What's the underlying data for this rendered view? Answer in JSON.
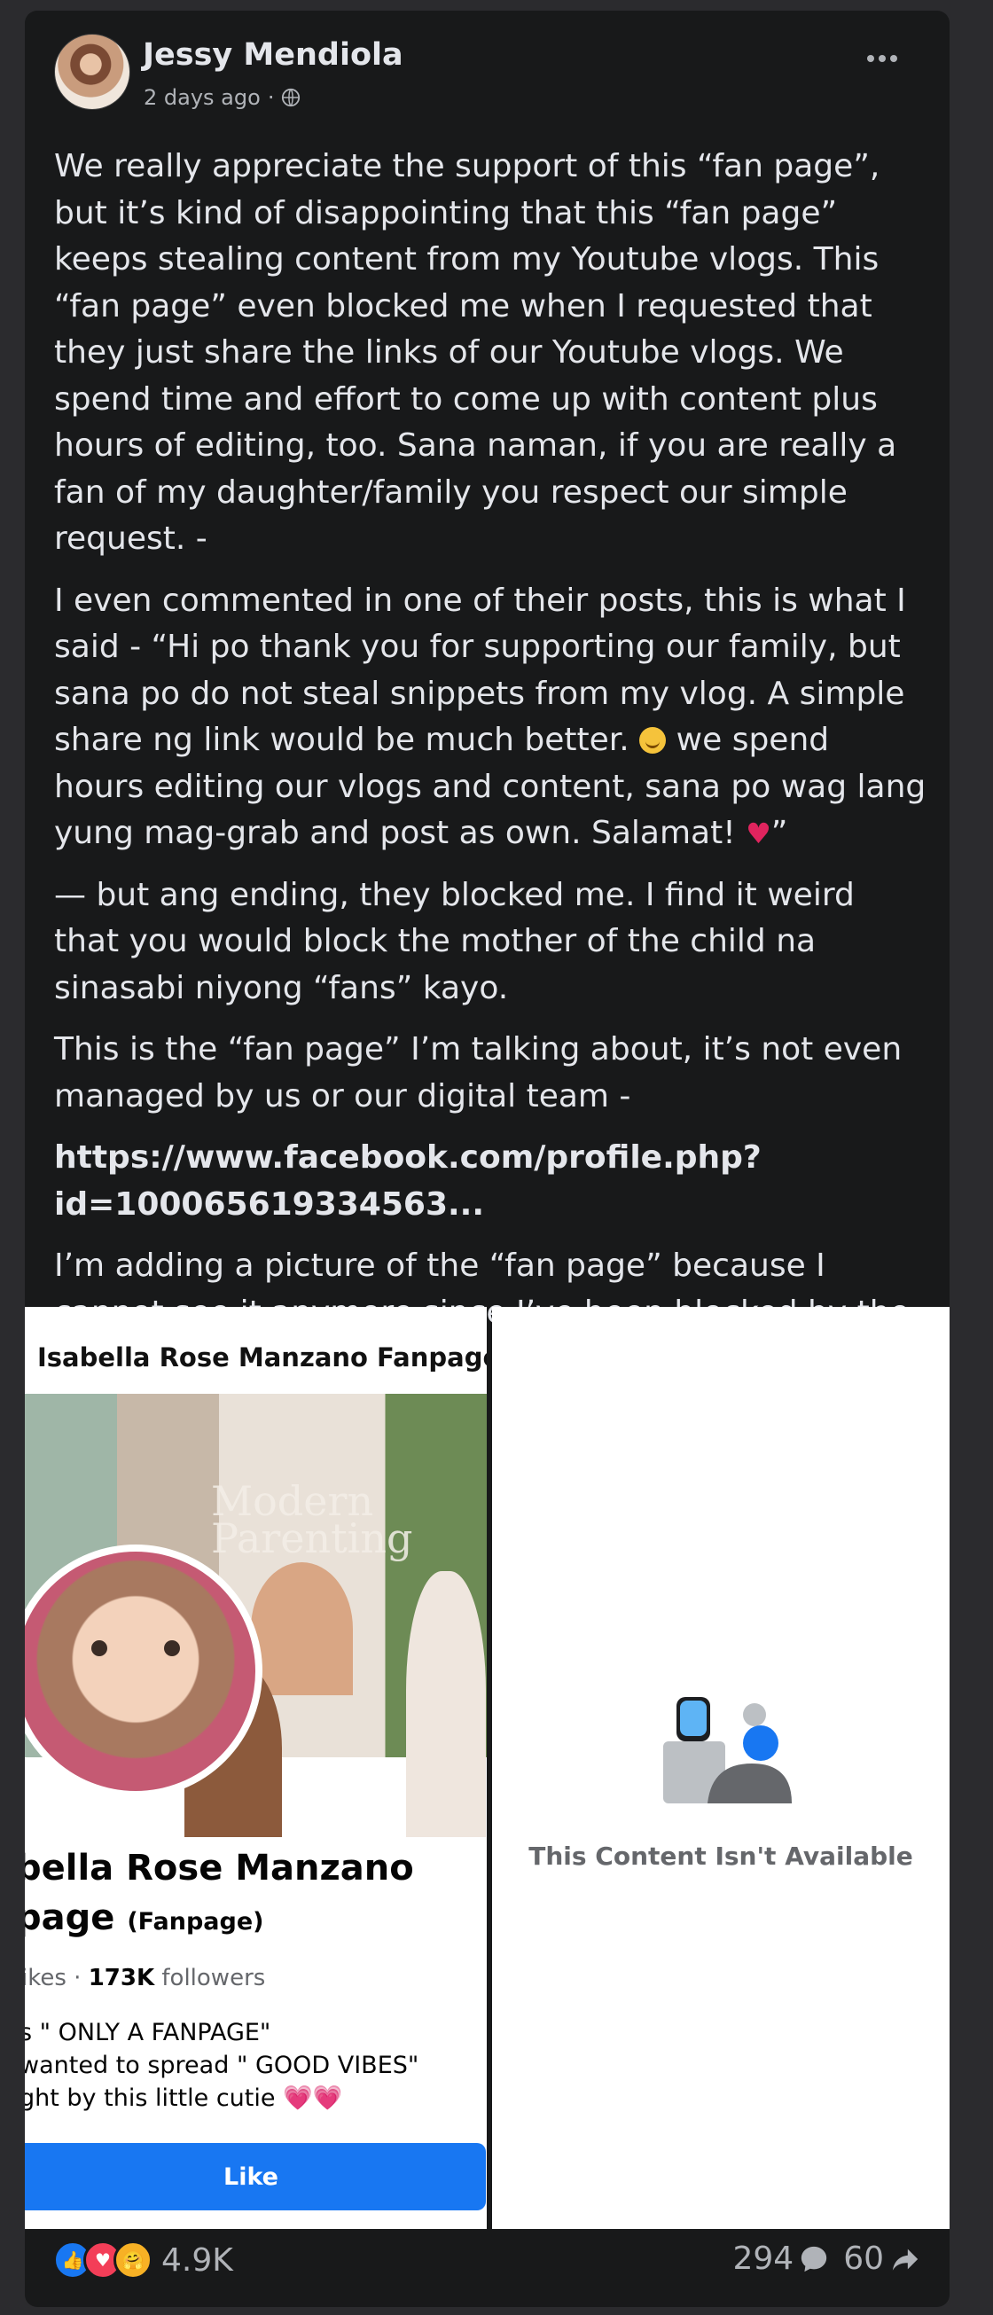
{
  "post": {
    "author": "Jessy Mendiola",
    "timestamp": "2 days ago",
    "separator": "·",
    "more_icon": "ellipsis-icon",
    "paragraphs": [
      "We really appreciate the support of this “fan page”, but it’s kind of disappointing that this “fan page” keeps stealing content from my Youtube vlogs. This “fan page” even blocked me when I requested that they just share the links of our Youtube vlogs. We spend time and effort to come up with content plus hours of editing, too. Sana naman, if you are really a fan of my daughter/family you respect our simple request. -",
      "— but ang ending, they blocked me. I find it weird that you would block the mother of the child na sinasabi niyong “fans” kayo.",
      "This is the “fan page” I’m talking about, it’s not even managed by us or our digital team -",
      "I’m adding a picture of the “fan page” because I cannot see it anymore since I’ve been blocked by the admin."
    ],
    "quote_part1": "I even commented in one of their posts, this is what I said - “Hi po thank you for supporting our family, but sana po do not steal snippets from my vlog. A simple share ng link would be much better.",
    "quote_part2": "we spend hours editing our vlogs and content, sana po wag lang yung mag-grab and post as own. Salamat!",
    "quote_close": "”",
    "link_text": "https://www.facebook.com/profile.php?id=100065619334563..."
  },
  "fanpage_screenshot": {
    "header_title": "Isabella Rose Manzano Fanpage",
    "cover_text": "Modern Parenting",
    "name_line1": "bella Rose Manzano",
    "name_line2": "page",
    "name_suffix": "(Fanpage)",
    "likes_label": "ikes",
    "dot": "·",
    "followers_count": "173K",
    "followers_label": "followers",
    "bio_line1": "s \" ONLY A FANPAGE\"",
    "bio_line2": "wanted to spread \" GOOD VIBES\"",
    "bio_line3": "ght by this little cutie 💗💗",
    "like_button": "Like"
  },
  "unavailable": {
    "icon": "people-unavailable-icon",
    "text": "This Content Isn't Available"
  },
  "footer": {
    "reaction_icons": [
      "like-icon",
      "love-icon",
      "care-icon"
    ],
    "reaction_count": "4.9K",
    "comment_count": "294",
    "share_count": "60"
  },
  "colors": {
    "card_bg": "#18191a",
    "text_primary": "#e4e6eb",
    "text_secondary": "#b0b3b8",
    "accent_blue": "#1877f2"
  }
}
